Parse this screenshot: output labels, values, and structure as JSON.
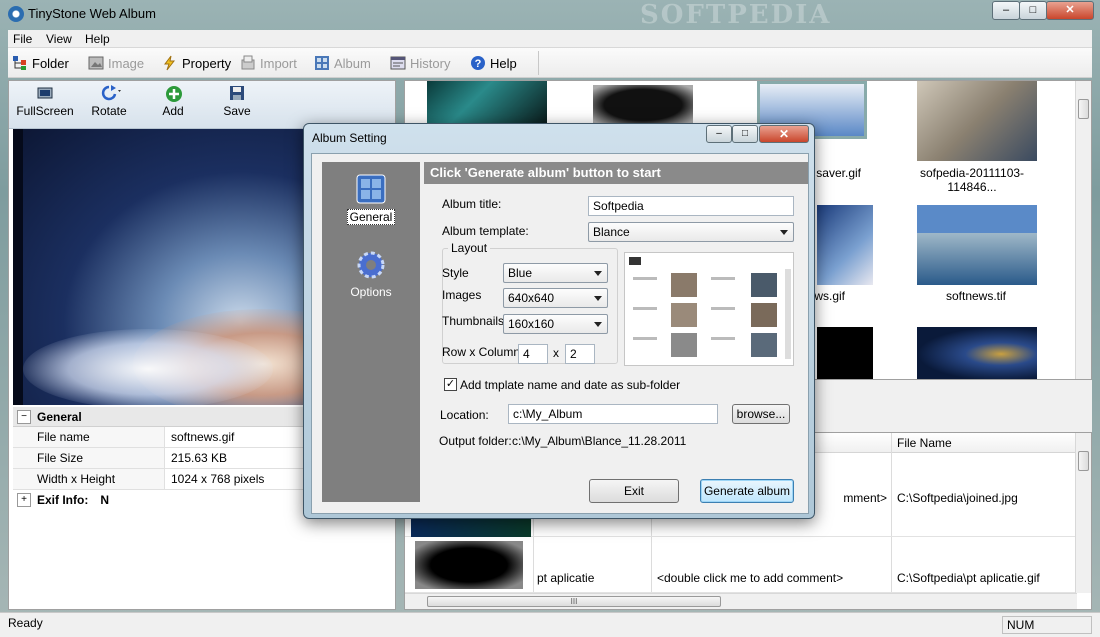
{
  "app": {
    "title": "TinyStone Web Album",
    "watermark": "SOFTPEDIA",
    "window_buttons": {
      "minimize": "–",
      "maximize": "□",
      "close": "✕"
    }
  },
  "menu": [
    "File",
    "View",
    "Help"
  ],
  "toolbar": [
    {
      "label": "Folder",
      "icon": "folder-tree-icon",
      "enabled": true
    },
    {
      "label": "Image",
      "icon": "image-icon",
      "enabled": false
    },
    {
      "label": "Property",
      "icon": "lightning-icon",
      "enabled": true
    },
    {
      "label": "Import",
      "icon": "import-icon",
      "enabled": false
    },
    {
      "label": "Album",
      "icon": "album-icon",
      "enabled": false
    },
    {
      "label": "History",
      "icon": "history-icon",
      "enabled": false
    },
    {
      "label": "Help",
      "icon": "help-icon",
      "enabled": true
    }
  ],
  "image_tools": [
    {
      "label": "FullScreen",
      "icon": "fullscreen-icon"
    },
    {
      "label": "Rotate",
      "icon": "rotate-icon"
    },
    {
      "label": "Add",
      "icon": "add-icon"
    },
    {
      "label": "Save",
      "icon": "save-icon"
    }
  ],
  "properties": {
    "general_label": "General",
    "expand_minus": "−",
    "expand_plus": "+",
    "rows": [
      {
        "key": "File name",
        "value": "softnews.gif"
      },
      {
        "key": "File Size",
        "value": "215.63 KB"
      },
      {
        "key": "Width x Height",
        "value": "1024 x 768 pixels"
      }
    ],
    "exif_label": "Exif Info:",
    "exif_value": "N"
  },
  "thumbnails": {
    "captions": [
      "saver.gif",
      "sofpedia-20111103-114846...",
      "ws.gif",
      "softnews.tif"
    ]
  },
  "file_grid": {
    "headers": {
      "file_name": "File Name"
    },
    "rows": [
      {
        "name": "",
        "comment": "mment>",
        "file_name": "C:\\Softpedia\\joined.jpg"
      },
      {
        "name": "pt aplicatie",
        "comment": "<double click me to add comment>",
        "file_name": "C:\\Softpedia\\pt aplicatie.gif"
      }
    ],
    "hscroll_grip": "III"
  },
  "status": {
    "text": "Ready",
    "num": "NUM"
  },
  "dialog": {
    "title": "Album Setting",
    "window_buttons": {
      "minimize": "–",
      "maximize": "□",
      "close": "✕"
    },
    "nav": [
      {
        "label": "General",
        "icon": "general-icon",
        "active": true
      },
      {
        "label": "Options",
        "icon": "options-gear-icon",
        "active": false
      }
    ],
    "header": "Click 'Generate album' button to start",
    "album_title_label": "Album title:",
    "album_title_value": "Softpedia",
    "album_template_label": "Album template:",
    "album_template_value": "Blance",
    "layout_label": "Layout",
    "style_label": "Style",
    "style_value": "Blue",
    "images_label": "Images",
    "images_value": "640x640",
    "thumbnails_label": "Thumbnails",
    "thumbnails_value": "160x160",
    "rowcol_label": "Row x Column:",
    "rows_value": "4",
    "times": "x",
    "cols_value": "2",
    "subfolder_checkbox_label": "Add tmplate name and date as sub-folder",
    "subfolder_checked": true,
    "check_mark": "✓",
    "location_label": "Location:",
    "location_value": "c:\\My_Album",
    "browse_label": "browse...",
    "output_label": "Output folder:",
    "output_value": "c:\\My_Album\\Blance_11.28.2011",
    "exit_label": "Exit",
    "generate_label": "Generate album"
  }
}
